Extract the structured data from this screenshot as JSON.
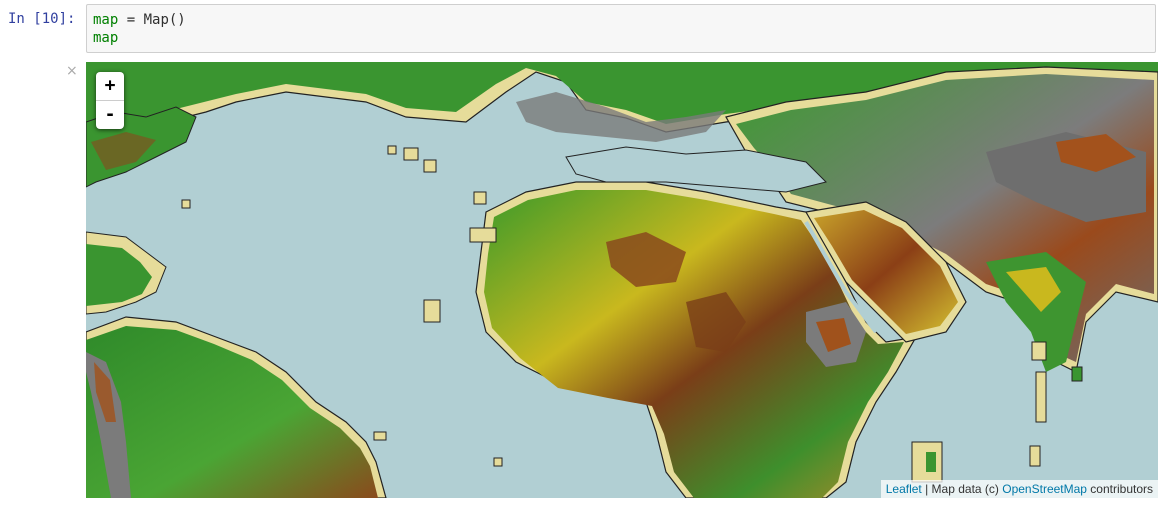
{
  "cell": {
    "prompt": "In [10]:",
    "code_lines": [
      {
        "var": "map",
        "op": " = ",
        "call": "Map()"
      },
      {
        "var": "map",
        "op": "",
        "call": ""
      }
    ]
  },
  "output": {
    "close_symbol": "×",
    "zoom": {
      "in_label": "+",
      "out_label": "-"
    },
    "attribution": {
      "leaflet": "Leaflet",
      "separator": " | Map data (c) ",
      "osm": "OpenStreetMap",
      "suffix": " contributors"
    }
  },
  "colors": {
    "ocean": "#b1cfd3",
    "coast": "#e6dc9a",
    "land_green": "#2f8a2a",
    "land_yellow": "#d7c21a",
    "land_brown": "#8a4a1c",
    "mountain_gray": "#7a7a7a"
  }
}
